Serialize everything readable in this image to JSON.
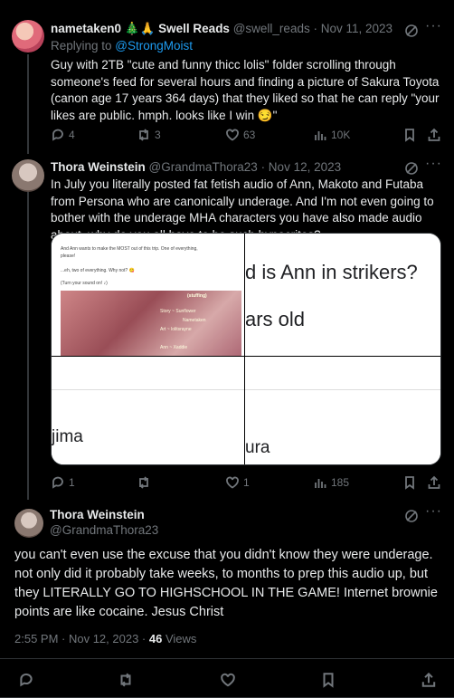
{
  "tweets": [
    {
      "name": "nametaken0 🎄🙏 Swell Reads",
      "handle": "@swell_reads",
      "time": "· Nov 11, 2023",
      "replying_to_prefix": "Replying to ",
      "replying_to": "@StrongMoist",
      "text": "Guy with 2TB \"cute and funny thicc lolis\" folder scrolling through someone's feed for several hours and finding a picture of Sakura Toyota (canon age 17 years 364 days) that they liked so that he can reply \"your likes are public. hmph. looks like I win 😏\"",
      "stats": {
        "replies": "4",
        "reposts": "3",
        "likes": "63",
        "views": "10K"
      }
    },
    {
      "name": "Thora Weinstein",
      "handle": "@GrandmaThora23",
      "time": "· Nov 12, 2023",
      "text": "In July you literally posted fat fetish audio of Ann, Makoto and Futaba from Persona who are canonically underage. And I'm not even going to bother with the underage MHA characters you have also made audio about. why do you all have to be such hypocrites?",
      "stats": {
        "replies": "1",
        "reposts": "",
        "likes": "1",
        "views": "185"
      },
      "media": {
        "cell1_lines": [
          "And Ann wants to make the MOST out of this trip. One of everything,",
          "please!",
          "...eh, two of everything. Why not? 😋",
          "(Turn your sound on! ♪)"
        ],
        "cell1_box_header": "(stuffing)",
        "cell1_box_lines": [
          "Story ~ Sunflower",
          "Nametaken",
          "Art ~ lolitsrayne",
          "Ann ~ Xaddie"
        ],
        "cell2_text": "d is Ann in strikers?",
        "cell2_sub": "ars old",
        "cell3_text": "jima",
        "cell4_text": "ura"
      }
    }
  ],
  "main": {
    "name": "Thora Weinstein",
    "handle": "@GrandmaThora23",
    "text": "you can't even use the excuse that you didn't know they were underage. not only did it probably take weeks, to months to prep this audio up, but they LITERALLY GO TO HIGHSCHOOL IN THE GAME! Internet brownie points are like cocaine. Jesus Christ",
    "time": "2:55 PM · Nov 12, 2023 ·",
    "views_count": "46",
    "views_label": "Views"
  }
}
